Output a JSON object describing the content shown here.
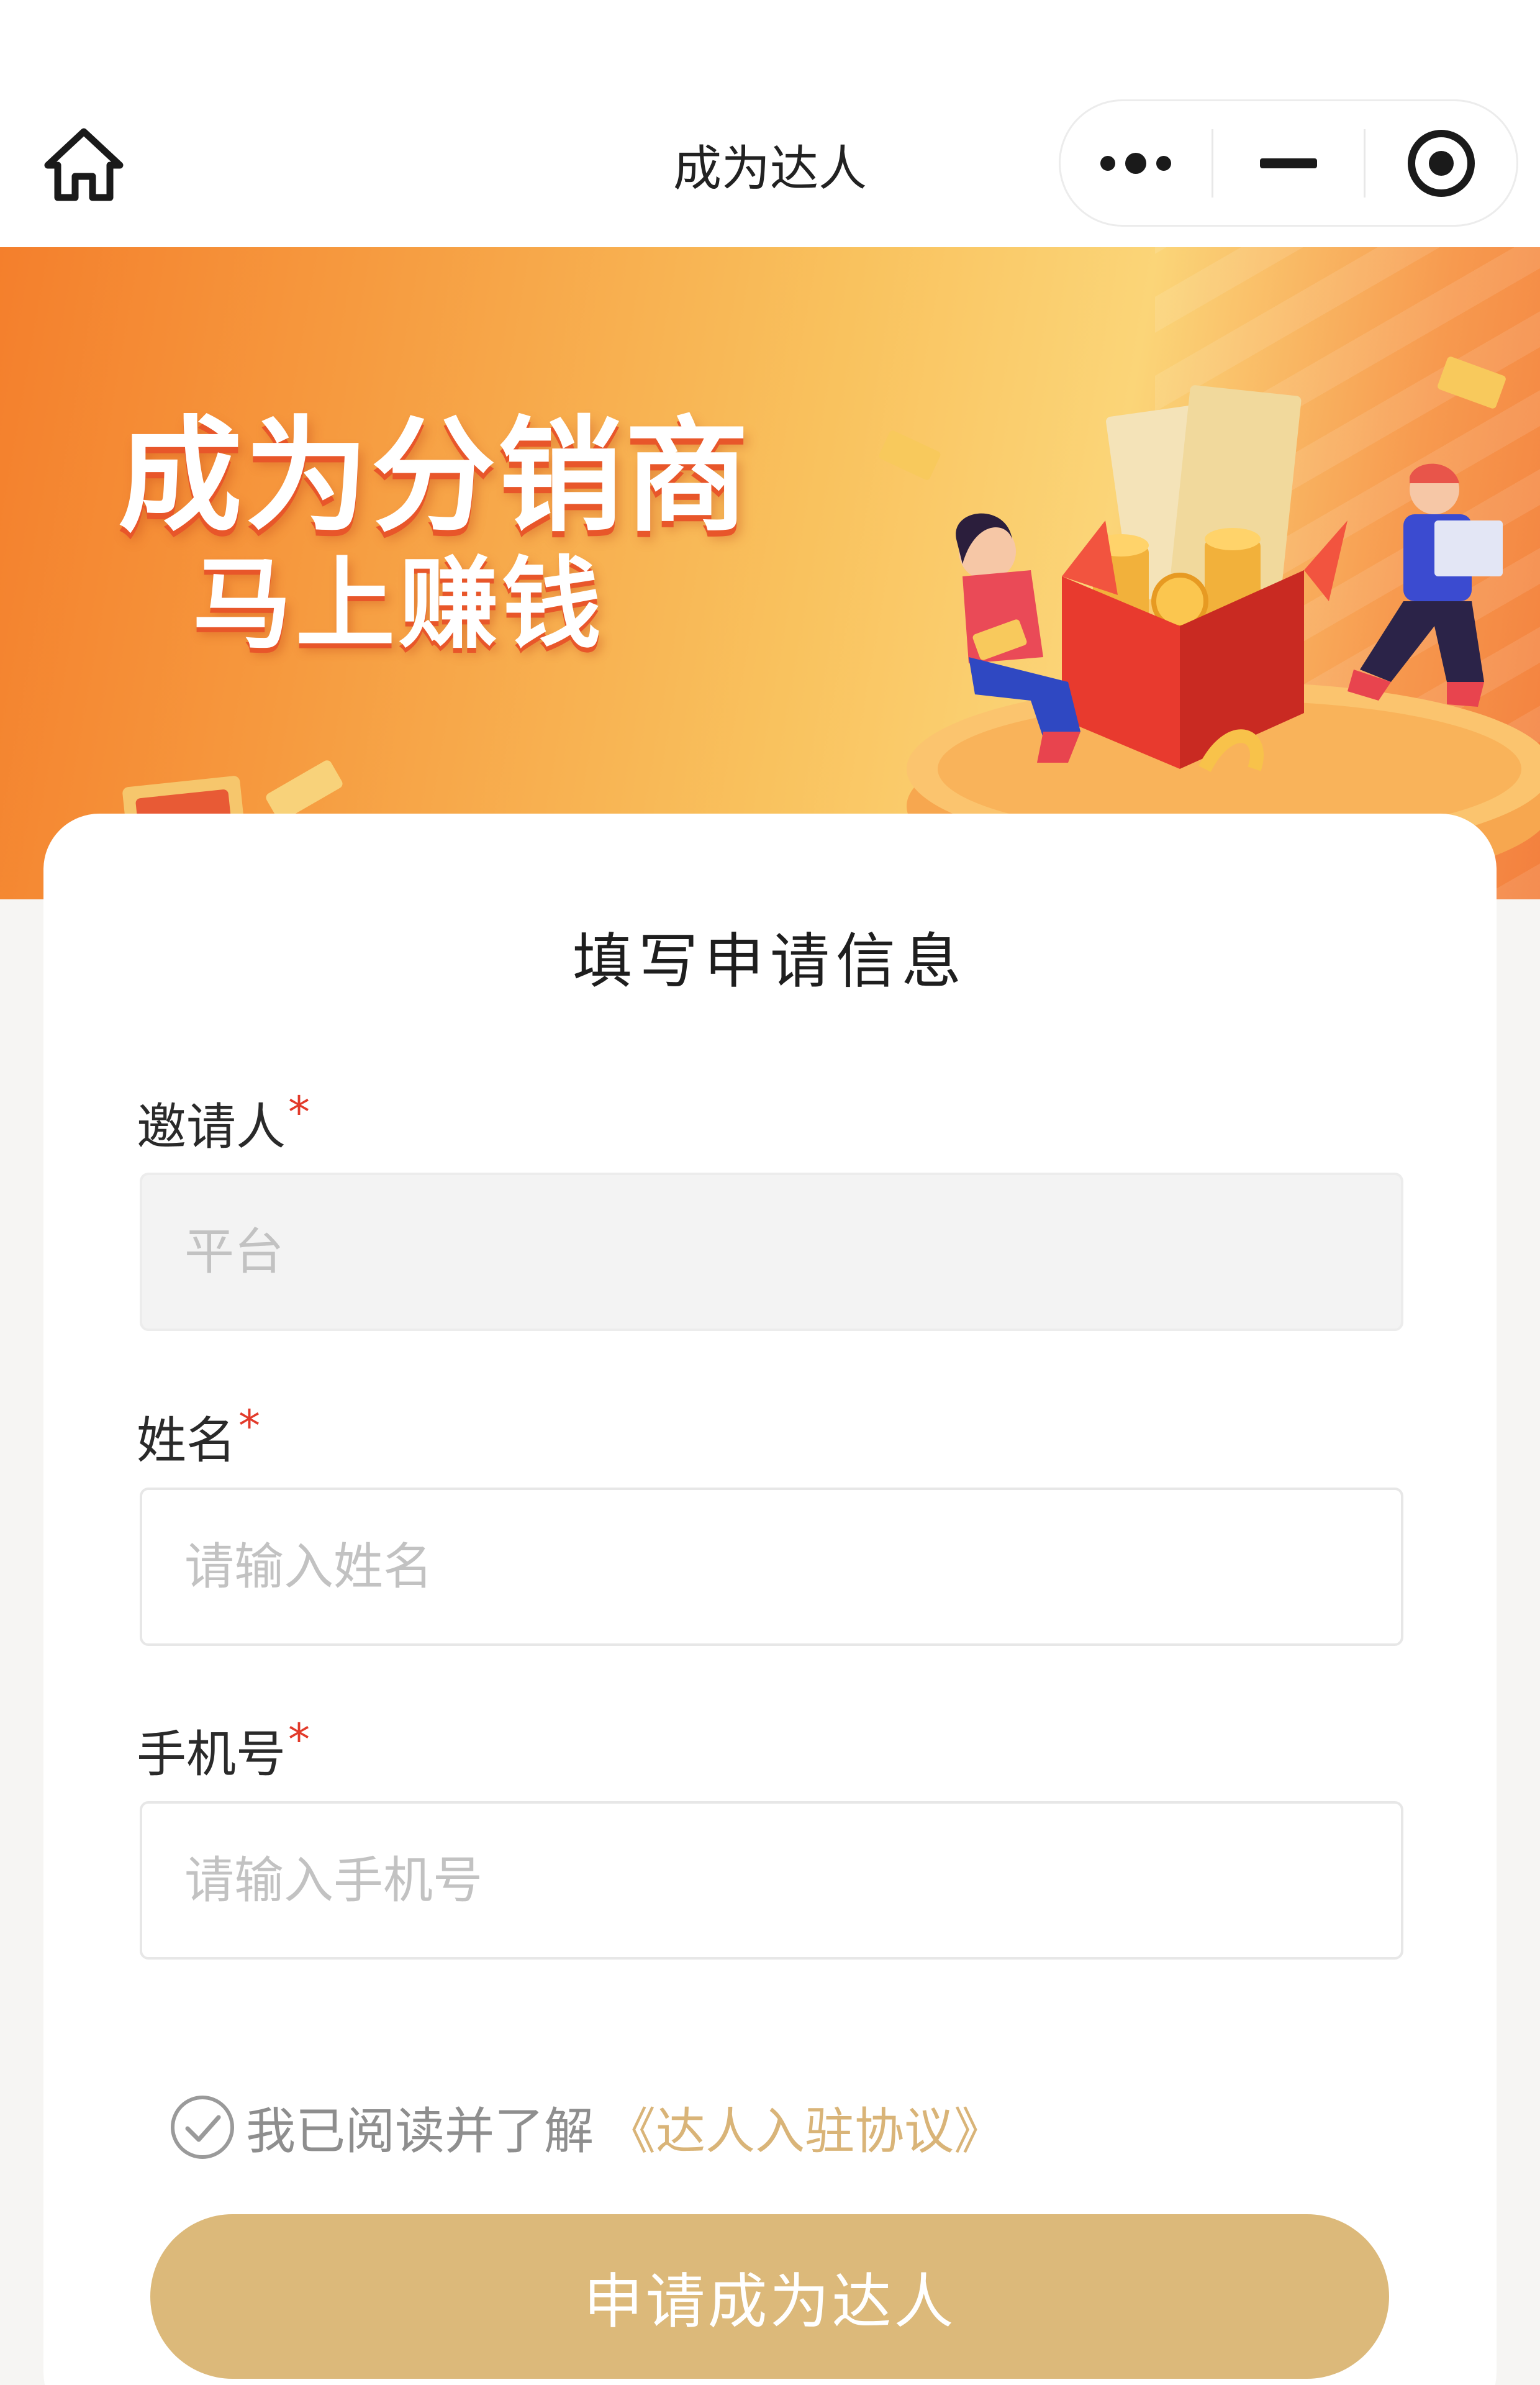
{
  "navbar": {
    "title": "成为达人",
    "home_icon": "home-icon",
    "more_icon": "more-dots-icon",
    "minimize_icon": "minimize-icon",
    "close_icon": "record-close-icon"
  },
  "banner": {
    "title": "成为分销商",
    "subtitle": "马上赚钱"
  },
  "form": {
    "title": "填写申请信息",
    "required_mark": "*",
    "inviter": {
      "label": "邀请人",
      "placeholder": "平台",
      "value": "",
      "disabled": true
    },
    "name": {
      "label": "姓名",
      "placeholder": "请输入姓名",
      "value": ""
    },
    "phone": {
      "label": "手机号",
      "placeholder": "请输入手机号",
      "value": ""
    },
    "agreement": {
      "checked": false,
      "text": "我已阅读并了解",
      "link_text": "《达人入驻协议》"
    },
    "submit_label": "申请成为达人"
  },
  "colors": {
    "accent_gold": "#dcb97a",
    "link_gold": "#d9b478",
    "required_red": "#e23a2a",
    "banner_orange": "#f47f2c"
  }
}
